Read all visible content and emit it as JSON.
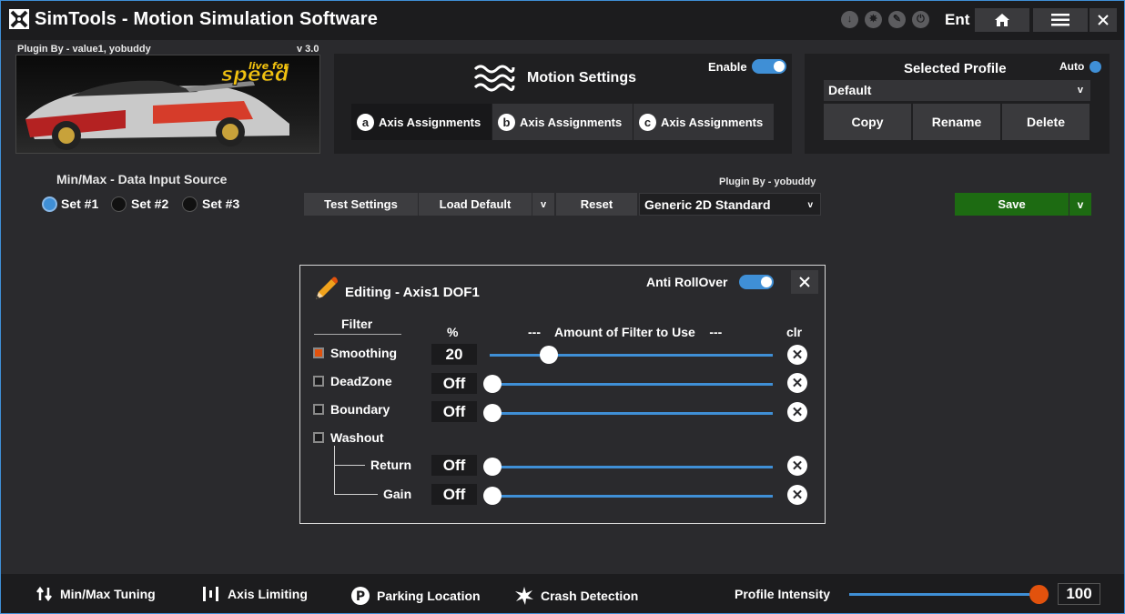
{
  "app": {
    "title": "SimTools - Motion Simulation Software",
    "ent_label": "Ent"
  },
  "plugin": {
    "by_label": "Plugin By - value1, yobuddy",
    "version": "v 3.0",
    "image_logo_text": "live for speed"
  },
  "motion_settings": {
    "title": "Motion Settings",
    "enable_label": "Enable",
    "enable_on": true,
    "axis_buttons": [
      {
        "letter": "a",
        "label": "Axis Assignments"
      },
      {
        "letter": "b",
        "label": "Axis Assignments"
      },
      {
        "letter": "c",
        "label": "Axis Assignments"
      }
    ]
  },
  "profile": {
    "title": "Selected Profile",
    "auto_label": "Auto",
    "selected": "Default",
    "buttons": [
      "Copy",
      "Rename",
      "Delete"
    ]
  },
  "data_input": {
    "label": "Min/Max - Data Input Source",
    "options": [
      "Set #1",
      "Set #2",
      "Set #3"
    ],
    "selected_index": 0
  },
  "toolbar": {
    "plugin_by": "Plugin By - yobuddy",
    "test_settings": "Test Settings",
    "load_default": "Load Default",
    "dropdown_arrow": "v",
    "reset": "Reset",
    "preset": "Generic 2D Standard",
    "save": "Save",
    "save_arrow": "v"
  },
  "editor": {
    "title": "Editing - Axis1 DOF1",
    "anti_rollover_label": "Anti RollOver",
    "anti_rollover_on": true,
    "filter_header": "Filter",
    "percent_header": "%",
    "amount_header": "---    Amount of Filter to Use    ---",
    "clr_header": "clr",
    "rows": [
      {
        "label": "Smoothing",
        "checked": true,
        "value": "20",
        "level": 0.2
      },
      {
        "label": "DeadZone",
        "checked": false,
        "value": "Off",
        "level": 0
      },
      {
        "label": "Boundary",
        "checked": false,
        "value": "Off",
        "level": 0
      },
      {
        "label": "Washout",
        "checked": false
      },
      {
        "label": "Return",
        "value": "Off",
        "level": 0
      },
      {
        "label": "Gain",
        "value": "Off",
        "level": 0
      }
    ]
  },
  "bottom": {
    "items": [
      "Min/Max Tuning",
      "Axis Limiting",
      "Parking Location",
      "Crash Detection"
    ],
    "profile_intensity_label": "Profile Intensity",
    "profile_intensity_value": "100",
    "profile_intensity_level": 1.0
  },
  "colors": {
    "accent": "#3f8fd6",
    "save_green": "#1d6b12",
    "orange": "#e2520d"
  }
}
